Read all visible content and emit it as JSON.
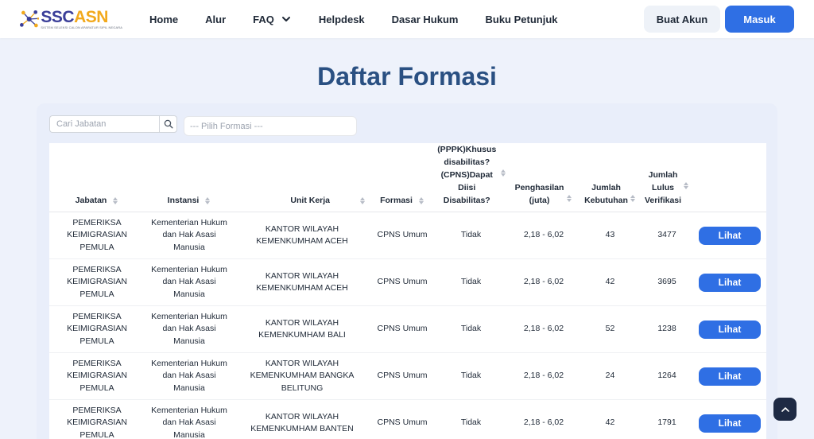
{
  "header": {
    "logo_name_1": "SSC",
    "logo_name_2": "ASN",
    "logo_subtitle": "SISTEM SELEKSI CALON APARATUR SIPIL NEGARA",
    "nav": {
      "home": "Home",
      "alur": "Alur",
      "faq": "FAQ",
      "helpdesk": "Helpdesk",
      "dasar_hukum": "Dasar Hukum",
      "buku_petunjuk": "Buku Petunjuk"
    },
    "buat_akun": "Buat Akun",
    "masuk": "Masuk"
  },
  "page": {
    "title": "Daftar Formasi"
  },
  "filters": {
    "search_placeholder": "Cari Jabatan",
    "formasi_placeholder": "--- Pilih Formasi ---"
  },
  "table": {
    "columns": {
      "jabatan": "Jabatan",
      "instansi": "Instansi",
      "unit_kerja": "Unit Kerja",
      "formasi": "Formasi",
      "disabilitas_1": "(PPPK)Khusus",
      "disabilitas_2": "disabilitas?",
      "disabilitas_3": "(CPNS)Dapat",
      "disabilitas_4": "Diisi Disabilitas?",
      "penghasilan_1": "Penghasilan",
      "penghasilan_2": "(juta)",
      "kebutuhan_1": "Jumlah",
      "kebutuhan_2": "Kebutuhan",
      "lulus_1": "Jumlah",
      "lulus_2": "Lulus",
      "lulus_3": "Verifikasi"
    },
    "action_label": "Lihat",
    "rows": [
      {
        "jabatan": [
          "PEMERIKSA",
          "KEIMIGRASIAN",
          "PEMULA"
        ],
        "instansi": [
          "Kementerian Hukum",
          "dan Hak Asasi",
          "Manusia"
        ],
        "unit_kerja": [
          "KANTOR WILAYAH",
          "KEMENKUMHAM ACEH"
        ],
        "formasi": "CPNS Umum",
        "disabilitas": "Tidak",
        "penghasilan": "2,18 - 6,02",
        "kebutuhan": "43",
        "lulus": "3477"
      },
      {
        "jabatan": [
          "PEMERIKSA",
          "KEIMIGRASIAN",
          "PEMULA"
        ],
        "instansi": [
          "Kementerian Hukum",
          "dan Hak Asasi",
          "Manusia"
        ],
        "unit_kerja": [
          "KANTOR WILAYAH",
          "KEMENKUMHAM ACEH"
        ],
        "formasi": "CPNS Umum",
        "disabilitas": "Tidak",
        "penghasilan": "2,18 - 6,02",
        "kebutuhan": "42",
        "lulus": "3695"
      },
      {
        "jabatan": [
          "PEMERIKSA",
          "KEIMIGRASIAN",
          "PEMULA"
        ],
        "instansi": [
          "Kementerian Hukum",
          "dan Hak Asasi",
          "Manusia"
        ],
        "unit_kerja": [
          "KANTOR WILAYAH",
          "KEMENKUMHAM BALI"
        ],
        "formasi": "CPNS Umum",
        "disabilitas": "Tidak",
        "penghasilan": "2,18 - 6,02",
        "kebutuhan": "52",
        "lulus": "1238"
      },
      {
        "jabatan": [
          "PEMERIKSA",
          "KEIMIGRASIAN",
          "PEMULA"
        ],
        "instansi": [
          "Kementerian Hukum",
          "dan Hak Asasi",
          "Manusia"
        ],
        "unit_kerja": [
          "KANTOR WILAYAH",
          "KEMENKUMHAM BANGKA",
          "BELITUNG"
        ],
        "formasi": "CPNS Umum",
        "disabilitas": "Tidak",
        "penghasilan": "2,18 - 6,02",
        "kebutuhan": "24",
        "lulus": "1264"
      },
      {
        "jabatan": [
          "PEMERIKSA",
          "KEIMIGRASIAN",
          "PEMULA"
        ],
        "instansi": [
          "Kementerian Hukum",
          "dan Hak Asasi",
          "Manusia"
        ],
        "unit_kerja": [
          "KANTOR WILAYAH",
          "KEMENKUMHAM BANTEN"
        ],
        "formasi": "CPNS Umum",
        "disabilitas": "Tidak",
        "penghasilan": "2,18 - 6,02",
        "kebutuhan": "42",
        "lulus": "1791"
      }
    ]
  },
  "colors": {
    "primary": "#2f6fe4",
    "title": "#2a5082",
    "logo_blue": "#3b3f99",
    "logo_gold": "#f2a91c",
    "background": "#eef2fb"
  },
  "icons": {
    "logo": "people-network-logo",
    "faq_dropdown": "chevron-down-icon",
    "search": "search-icon",
    "sort": "sort-icon",
    "scroll_top": "chevron-up-icon"
  }
}
